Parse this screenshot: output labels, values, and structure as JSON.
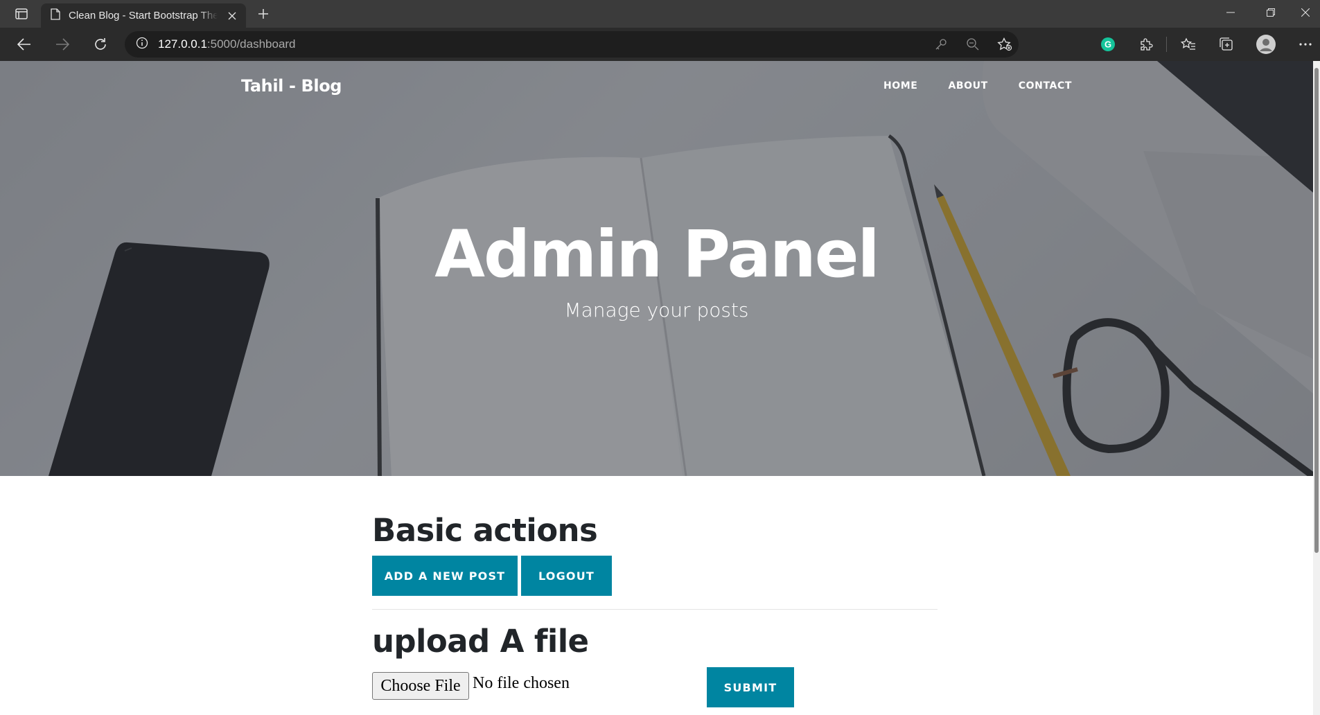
{
  "browser": {
    "tab_title": "Clean Blog - Start Bootstrap Theme",
    "url_host": "127.0.0.1",
    "url_rest": ":5000/dashboard"
  },
  "site": {
    "brand": "Tahil - Blog",
    "nav": [
      "HOME",
      "ABOUT",
      "CONTACT"
    ]
  },
  "hero": {
    "title": "Admin Panel",
    "subtitle": "Manage your posts"
  },
  "basic_actions": {
    "heading": "Basic actions",
    "add_post_label": "ADD A NEW POST",
    "logout_label": "LOGOUT"
  },
  "upload": {
    "heading": "upload A file",
    "choose_label": "Choose File",
    "file_status": "No file chosen",
    "submit_label": "SUBMIT"
  },
  "colors": {
    "accent": "#0085a1",
    "heading": "#212529"
  }
}
